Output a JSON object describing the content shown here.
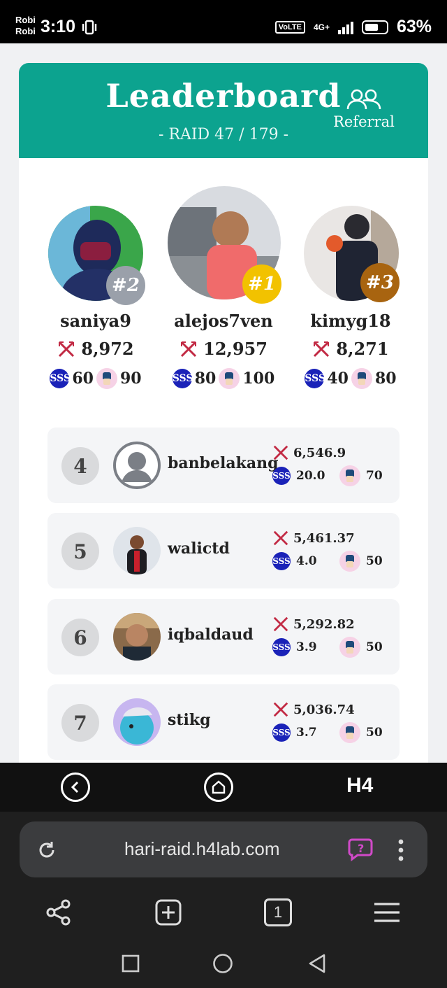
{
  "status_bar": {
    "carrier1": "Robi",
    "carrier2": "Robi",
    "time": "3:10",
    "volte": "VoLTE",
    "network": "4G+",
    "battery": "63%"
  },
  "header": {
    "title": "Leaderboard",
    "subtitle": "- RAID 47 / 179 -",
    "referral_label": "Referral",
    "bg_color": "#0ca38f"
  },
  "podium": [
    {
      "rank": "#2",
      "name": "saniya9",
      "score": "8,972",
      "steem": "60",
      "pixel": "90",
      "badge_color": "#9aa0aa"
    },
    {
      "rank": "#1",
      "name": "alejos7ven",
      "score": "12,957",
      "steem": "80",
      "pixel": "100",
      "badge_color": "#f2c200"
    },
    {
      "rank": "#3",
      "name": "kimyg18",
      "score": "8,271",
      "steem": "40",
      "pixel": "80",
      "badge_color": "#a86410"
    }
  ],
  "list": [
    {
      "rank": "4",
      "name": "banbelakang",
      "score": "6,546.9",
      "steem": "20.0",
      "pixel": "70"
    },
    {
      "rank": "5",
      "name": "walictd",
      "score": "5,461.37",
      "steem": "4.0",
      "pixel": "50"
    },
    {
      "rank": "6",
      "name": "iqbaldaud",
      "score": "5,292.82",
      "steem": "3.9",
      "pixel": "50"
    },
    {
      "rank": "7",
      "name": "stikg",
      "score": "5,036.74",
      "steem": "3.7",
      "pixel": "50"
    }
  ],
  "browser": {
    "url": "hari-raid.h4lab.com",
    "brand": "H4",
    "tab_count": "1"
  },
  "icons": {
    "steem": "steem-coin-icon",
    "pixel": "pixel-character-icon",
    "score": "crossed-swords-icon"
  }
}
